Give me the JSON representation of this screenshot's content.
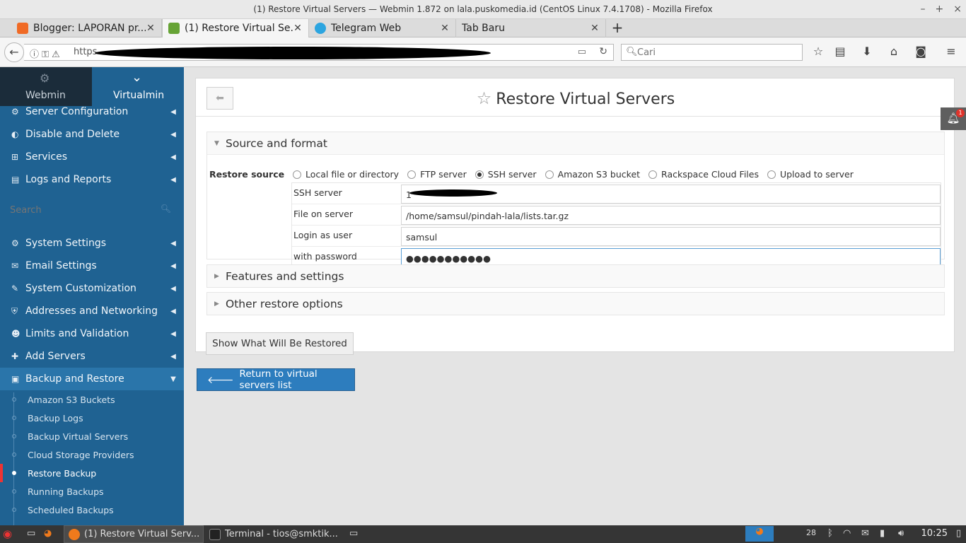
{
  "window": {
    "title": "(1) Restore Virtual Servers — Webmin 1.872 on lala.puskomedia.id (CentOS Linux 7.4.1708) - Mozilla Firefox",
    "minimize": "–",
    "maximize": "+",
    "close": "×"
  },
  "tabs": [
    {
      "label": "Blogger: LAPORAN pr...",
      "favicon": "blogger-icon",
      "color": "#f06a25"
    },
    {
      "label": "(1) Restore Virtual Se...",
      "favicon": "webmin-icon",
      "color": "#66a335"
    },
    {
      "label": "Telegram Web",
      "favicon": "telegram-icon",
      "color": "#2ca5e0"
    },
    {
      "label": "Tab Baru",
      "favicon": "",
      "color": ""
    }
  ],
  "navbar": {
    "url_prefix": "https",
    "search_placeholder": "Cari"
  },
  "sidebar": {
    "switch_webmin": "Webmin",
    "switch_virtualmin": "Virtualmin",
    "items_top": [
      {
        "label": "Server Configuration",
        "icon": "gears-icon"
      },
      {
        "label": "Disable and Delete",
        "icon": "toggle-icon"
      },
      {
        "label": "Services",
        "icon": "sitemap-icon"
      },
      {
        "label": "Logs and Reports",
        "icon": "file-icon"
      }
    ],
    "search_placeholder": "Search",
    "items_bottom": [
      {
        "label": "System Settings",
        "icon": "gear-icon"
      },
      {
        "label": "Email Settings",
        "icon": "envelope-icon"
      },
      {
        "label": "System Customization",
        "icon": "wrench-icon"
      },
      {
        "label": "Addresses and Networking",
        "icon": "shield-icon"
      },
      {
        "label": "Limits and Validation",
        "icon": "user-icon"
      },
      {
        "label": "Add Servers",
        "icon": "plus-icon"
      },
      {
        "label": "Backup and Restore",
        "icon": "save-icon"
      }
    ],
    "sub_items": [
      "Amazon S3 Buckets",
      "Backup Logs",
      "Backup Virtual Servers",
      "Cloud Storage Providers",
      "Restore Backup",
      "Running Backups",
      "Scheduled Backups"
    ],
    "active_sub_item": "Restore Backup"
  },
  "main": {
    "title": "Restore Virtual Servers",
    "section_source": "Source and format",
    "restore_source_label": "Restore source",
    "restore_options": [
      {
        "label": "Local file or directory",
        "selected": false
      },
      {
        "label": "FTP server",
        "selected": false
      },
      {
        "label": "SSH server",
        "selected": true
      },
      {
        "label": "Amazon S3 bucket",
        "selected": false
      },
      {
        "label": "Rackspace Cloud Files",
        "selected": false
      },
      {
        "label": "Upload to server",
        "selected": false
      }
    ],
    "ssh_fields": [
      {
        "label": "SSH server",
        "value": "1"
      },
      {
        "label": "File on server",
        "value": "/home/samsul/pindah-lala/lists.tar.gz"
      },
      {
        "label": "Login as user",
        "value": "samsul"
      },
      {
        "label": "with password",
        "value": "●●●●●●●●●●●"
      }
    ],
    "section_features": "Features and settings",
    "section_other": "Other restore options",
    "show_button": "Show What Will Be Restored",
    "return_button": "Return to virtual servers list",
    "notification_count": "1"
  },
  "taskbar": {
    "tasks": [
      {
        "label": "(1) Restore Virtual Serv...",
        "icon": "firefox-icon"
      },
      {
        "label": "Terminal - tios@smktik...",
        "icon": "terminal-icon"
      }
    ],
    "calendar_day": "28",
    "clock": "10:25"
  }
}
